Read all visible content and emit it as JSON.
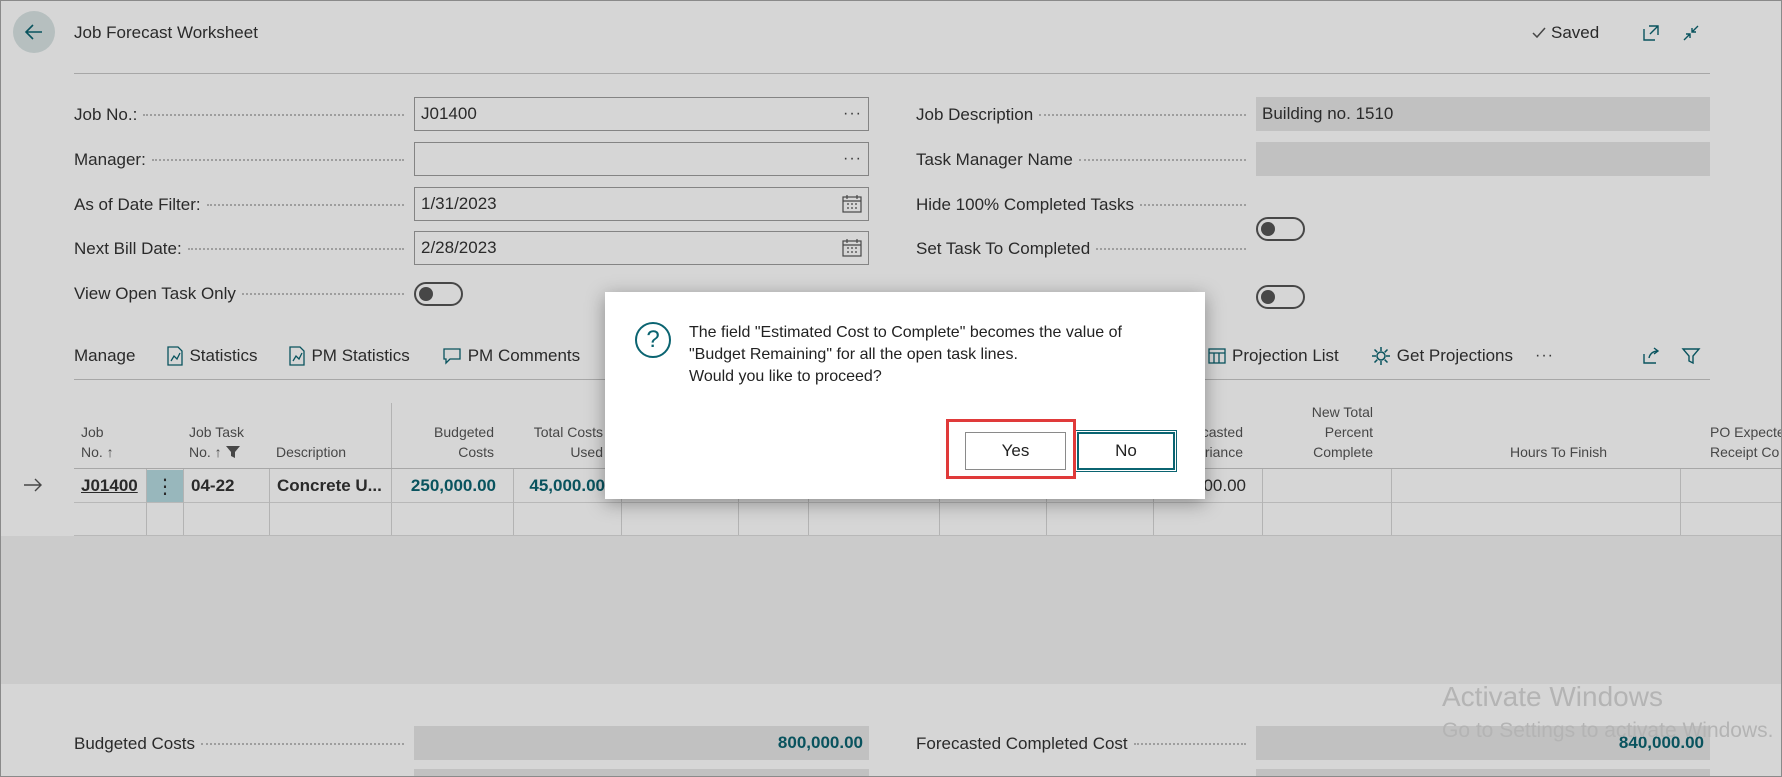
{
  "header": {
    "title": "Job Forecast Worksheet",
    "saved_label": "Saved"
  },
  "fields": {
    "job_no": {
      "label": "Job No.:",
      "value": "J01400"
    },
    "manager": {
      "label": "Manager:",
      "value": ""
    },
    "as_of_date": {
      "label": "As of Date Filter:",
      "value": "1/31/2023"
    },
    "next_bill_date": {
      "label": "Next Bill Date:",
      "value": "2/28/2023"
    },
    "view_open_task_only": {
      "label": "View Open Task Only",
      "on": false
    },
    "job_description": {
      "label": "Job Description",
      "value": "Building no. 1510"
    },
    "task_manager_name": {
      "label": "Task Manager Name",
      "value": ""
    },
    "hide_completed": {
      "label": "Hide 100% Completed Tasks",
      "on": false
    },
    "set_task_completed": {
      "label": "Set Task To Completed",
      "on": false
    }
  },
  "actions": {
    "manage": "Manage",
    "statistics": "Statistics",
    "pm_statistics": "PM Statistics",
    "pm_comments": "PM Comments",
    "projection_list": "Projection List",
    "get_projections": "Get Projections",
    "more": "···"
  },
  "grid": {
    "headers": {
      "job_no_1": "Job",
      "job_no_2": "No. ↑",
      "job_task_1": "Job Task",
      "job_task_2": "No. ↑",
      "description": "Description",
      "budgeted_1": "Budgeted",
      "budgeted_2": "Costs",
      "total_costs_1": "Total Costs",
      "total_costs_2": "Used",
      "forecasted_1": "casted",
      "forecasted_2": "riance",
      "new_total_1": "New Total",
      "new_total_2": "Percent",
      "new_total_3": "Complete",
      "hours_to_finish": "Hours To Finish",
      "po_expected_1": "PO Expecte",
      "po_expected_2": "Receipt Co"
    },
    "row": {
      "job_no": "J01400",
      "job_task_no": "04-22",
      "description": "Concrete U...",
      "budgeted_costs": "250,000.00",
      "total_costs_used": "45,000.00",
      "forecasted_variance": "00.00"
    }
  },
  "totals": {
    "budgeted_costs": {
      "label": "Budgeted Costs",
      "value": "800,000.00"
    },
    "forecasted_completed_cost": {
      "label": "Forecasted Completed Cost",
      "value": "840,000.00"
    }
  },
  "dialog": {
    "line1": "The field \"Estimated Cost to Complete\" becomes the value of",
    "line2": "\"Budget Remaining\" for all the open task lines.",
    "line3": "Would you like to proceed?",
    "yes_label": "Yes",
    "no_label": "No"
  },
  "watermark": {
    "line1": "Activate Windows",
    "line2": "Go to Settings to activate Windows."
  },
  "colors": {
    "accent": "#0b6471",
    "highlight": "#e03a3a"
  }
}
